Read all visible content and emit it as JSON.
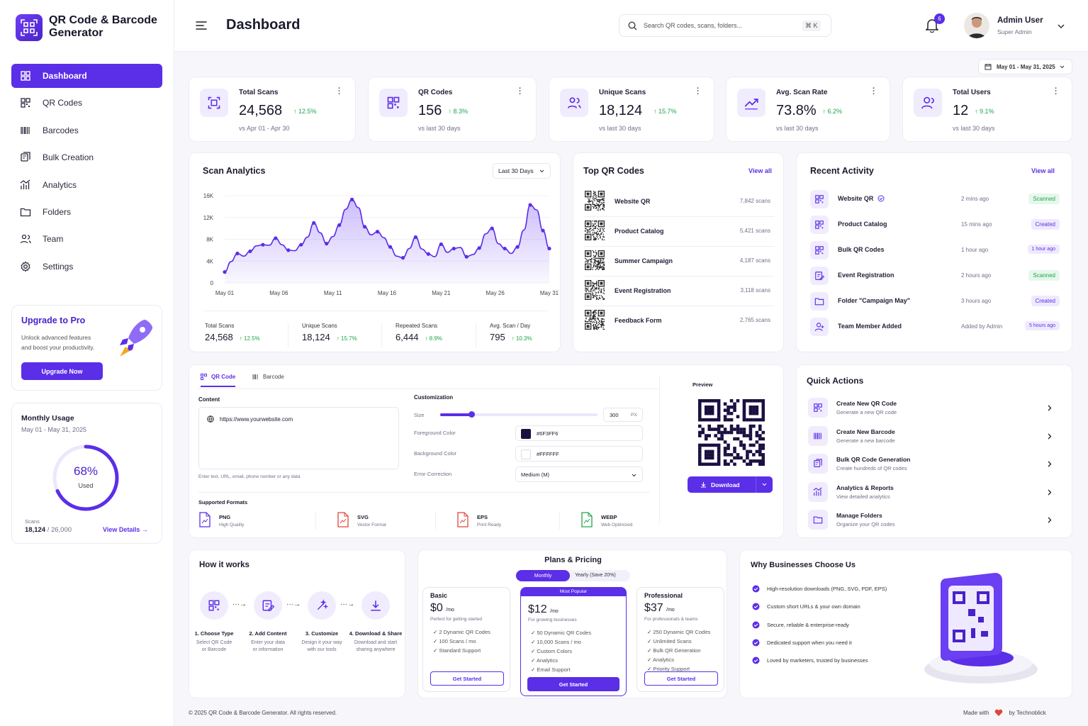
{
  "brand": {
    "name": "QR Code & Barcode Generator"
  },
  "nav": [
    {
      "label": "Dashboard",
      "icon": "dashboard-icon",
      "active": true
    },
    {
      "label": "QR Codes",
      "icon": "qr-icon"
    },
    {
      "label": "Barcodes",
      "icon": "barcode-icon"
    },
    {
      "label": "Bulk Creation",
      "icon": "bulk-icon"
    },
    {
      "label": "Analytics",
      "icon": "analytics-icon"
    },
    {
      "label": "Folders",
      "icon": "folder-icon"
    },
    {
      "label": "Team",
      "icon": "team-icon"
    },
    {
      "label": "Settings",
      "icon": "gear-icon"
    }
  ],
  "upgrade": {
    "title": "Upgrade to Pro",
    "text1": "Unlock advanced features",
    "text2": "and boost your productivity.",
    "button": "Upgrade Now"
  },
  "usage": {
    "title": "Monthly Usage",
    "period": "May 01 - May 31, 2025",
    "percent_label": "68%",
    "percent": 0.68,
    "used_label": "Used",
    "scans_label": "Scans",
    "scans_used": "18,124",
    "scans_total": " / 26,000",
    "view": "View Details"
  },
  "header": {
    "title": "Dashboard",
    "search_placeholder": "Search QR codes, scans, folders...",
    "shortcut": "⌘ K",
    "notifications": "6",
    "user_name": "Admin User",
    "user_role": "Super Admin",
    "date_range": "May 01 - May 31, 2025"
  },
  "stats": [
    {
      "title": "Total Scans",
      "value": "24,568",
      "change": "12.5%",
      "sub": "vs Apr 01 - Apr 30",
      "icon": "scan-icon"
    },
    {
      "title": "QR Codes",
      "value": "156",
      "change": "8.3%",
      "sub": "vs last 30 days",
      "icon": "qr-icon"
    },
    {
      "title": "Unique Scans",
      "value": "18,124",
      "change": "15.7%",
      "sub": "vs last 30 days",
      "icon": "users-icon"
    },
    {
      "title": "Avg. Scan Rate",
      "value": "73.8%",
      "change": "6.2%",
      "sub": "vs last 30 days",
      "icon": "trend-icon"
    },
    {
      "title": "Total Users",
      "value": "12",
      "change": "9.1%",
      "sub": "vs last 30 days",
      "icon": "user-icon"
    }
  ],
  "scan_analytics": {
    "title": "Scan Analytics",
    "range": "Last 30 Days",
    "summary": [
      {
        "label": "Total Scans",
        "value": "24,568",
        "change": "12.5%"
      },
      {
        "label": "Unique Scans",
        "value": "18,124",
        "change": "15.7%"
      },
      {
        "label": "Repeated Scans",
        "value": "6,444",
        "change": "8.9%"
      },
      {
        "label": "Avg. Scan / Day",
        "value": "795",
        "change": "10.3%"
      }
    ]
  },
  "chart_data": {
    "type": "area",
    "x": [
      "May 01",
      "May 02",
      "May 03",
      "May 04",
      "May 05",
      "May 06",
      "May 07",
      "May 08",
      "May 09",
      "May 10",
      "May 11",
      "May 12",
      "May 13",
      "May 14",
      "May 15",
      "May 16",
      "May 17",
      "May 18",
      "May 19",
      "May 20",
      "May 21",
      "May 22",
      "May 23",
      "May 24",
      "May 25",
      "May 26",
      "May 27",
      "May 28",
      "May 29",
      "May 30",
      "May 31"
    ],
    "values": [
      2000,
      3900,
      5400,
      4900,
      5800,
      6800,
      7000,
      6900,
      8200,
      7000,
      6000,
      5900,
      7000,
      8400,
      11000,
      9200,
      7200,
      8500,
      10600,
      13500,
      15300,
      13800,
      10300,
      8800,
      9400,
      8300,
      6600,
      4900,
      4600,
      6300,
      8400,
      6200,
      5300,
      4800,
      7100,
      5600,
      6300,
      6500,
      4800,
      5200,
      6400,
      9000,
      10000,
      7200,
      6300,
      5400,
      6600,
      9700,
      14300,
      13400,
      9600,
      6300
    ],
    "xticks": [
      "May 01",
      "May 06",
      "May 11",
      "May 16",
      "May 21",
      "May 26",
      "May 31"
    ],
    "yticks": [
      "0",
      "4K",
      "8K",
      "12K",
      "16K"
    ],
    "ylim": [
      0,
      16000
    ]
  },
  "top_qr": {
    "title": "Top QR Codes",
    "view_all": "View all",
    "items": [
      {
        "name": "Website QR",
        "scans": "7,842 scans"
      },
      {
        "name": "Product Catalog",
        "scans": "5,421 scans"
      },
      {
        "name": "Summer Campaign",
        "scans": "4,187 scans"
      },
      {
        "name": "Event Registration",
        "scans": "3,118 scans"
      },
      {
        "name": "Feedback Form",
        "scans": "2,765 scans"
      }
    ]
  },
  "activity": {
    "title": "Recent Activity",
    "view_all": "View all",
    "items": [
      {
        "name": "Website QR",
        "time": "2 mins ago",
        "badge": "Scanned",
        "tone": "green",
        "icon": "qr-icon"
      },
      {
        "name": "Product Catalog",
        "time": "15 mins ago",
        "badge": "Created",
        "tone": "purple",
        "icon": "qr-icon"
      },
      {
        "name": "Bulk QR Codes",
        "time": "1 hour ago",
        "badge": "1 hour ago",
        "tone": "purple",
        "icon": "qr-icon"
      },
      {
        "name": "Event Registration",
        "time": "2 hours ago",
        "badge": "Scanned",
        "tone": "green",
        "icon": "edit-icon"
      },
      {
        "name": "Folder \"Campaign May\"",
        "time": "3 hours ago",
        "badge": "Created",
        "tone": "purple",
        "icon": "folder-icon"
      },
      {
        "name": "Team Member Added",
        "time": "Added by Admin",
        "badge": "5 hours ago",
        "tone": "purple",
        "icon": "user-add-icon"
      }
    ]
  },
  "generator": {
    "tab_qr": "QR Code",
    "tab_barcode": "Barcode",
    "content_label": "Content",
    "content_value": "https://www.yourwebsite.com",
    "content_hint": "Enter text, URL, email, phone number or any data",
    "custom_label": "Customization",
    "size_label": "Size",
    "size_value": "300",
    "size_unit": "PX",
    "size_fraction": 0.2,
    "fg_label": "Foreground Color",
    "fg_value": "#6F3FF6",
    "fg_color": "#1a1040",
    "bg_label": "Background Color",
    "bg_value": "#FFFFFF",
    "ec_label": "Error Correction",
    "ec_value": "Medium (M)",
    "formats_label": "Supported Formats",
    "formats": [
      {
        "name": "PNG",
        "desc": "High Quality",
        "color": "#5b2ee8"
      },
      {
        "name": "SVG",
        "desc": "Vector Format",
        "color": "#e2453c"
      },
      {
        "name": "EPS",
        "desc": "Print Ready",
        "color": "#e2453c"
      },
      {
        "name": "WEBP",
        "desc": "Web Optimized",
        "color": "#1fa64a"
      }
    ],
    "preview_label": "Preview",
    "download": "Download"
  },
  "quick": {
    "title": "Quick Actions",
    "items": [
      {
        "title": "Create New QR Code",
        "desc": "Generate a new QR code",
        "icon": "qr-icon"
      },
      {
        "title": "Create New Barcode",
        "desc": "Generate a new barcode",
        "icon": "barcode-icon"
      },
      {
        "title": "Bulk QR Code Generation",
        "desc": "Create hundreds of QR codes",
        "icon": "bulk-icon"
      },
      {
        "title": "Analytics & Reports",
        "desc": "View detailed analytics",
        "icon": "analytics-icon"
      },
      {
        "title": "Manage Folders",
        "desc": "Organize your QR codes",
        "icon": "folder-icon"
      }
    ]
  },
  "how": {
    "title": "How it works",
    "steps": [
      {
        "title": "1. Choose Type",
        "l1": "Select QR Code",
        "l2": "or Barcode"
      },
      {
        "title": "2. Add Content",
        "l1": "Enter your data",
        "l2": "or information"
      },
      {
        "title": "3. Customize",
        "l1": "Design it your way",
        "l2": "with our tools"
      },
      {
        "title": "4. Download & Share",
        "l1": "Download and start",
        "l2": "sharing anywhere"
      }
    ]
  },
  "pricing": {
    "title": "Plans & Pricing",
    "monthly": "Monthly",
    "yearly": "Yearly (Save 20%)",
    "popular": "Most Popular",
    "plans": [
      {
        "name": "Basic",
        "price": "$0",
        "per": "/mo",
        "desc": "Perfect for getting started",
        "features": [
          "2 Dynamic QR Codes",
          "100 Scans / mo",
          "Standard Support"
        ],
        "cta": "Get Started"
      },
      {
        "name": "",
        "price": "$12",
        "per": "/mo",
        "desc": "For growing businesses",
        "features": [
          "50 Dynamic QR Codes",
          "10,000 Scans / mo",
          "Custom Colors",
          "Analytics",
          "Email Support"
        ],
        "cta": "Get Started"
      },
      {
        "name": "Professional",
        "price": "$37",
        "per": "/mo",
        "desc": "For professionals & teams",
        "features": [
          "250 Dynamic QR Codes",
          "Unlimited Scans",
          "Bulk QR Generation",
          "Analytics",
          "Priority Support"
        ],
        "cta": "Get Started"
      }
    ]
  },
  "why": {
    "title": "Why Businesses Choose Us",
    "items": [
      "High-resolution downloads (PNG, SVG, PDF, EPS)",
      "Custom short URLs & your own domain",
      "Secure, reliable & enterprise-ready",
      "Dedicated support when you need it",
      "Loved by marketers, trusted by businesses"
    ]
  },
  "footer": {
    "copy": "© 2025 QR Code & Barcode Generator. All rights reserved.",
    "made": "Made with",
    "by": "by Technoblick"
  },
  "colors": {
    "accent": "#5b2ee8",
    "positive": "#1fa64a"
  }
}
